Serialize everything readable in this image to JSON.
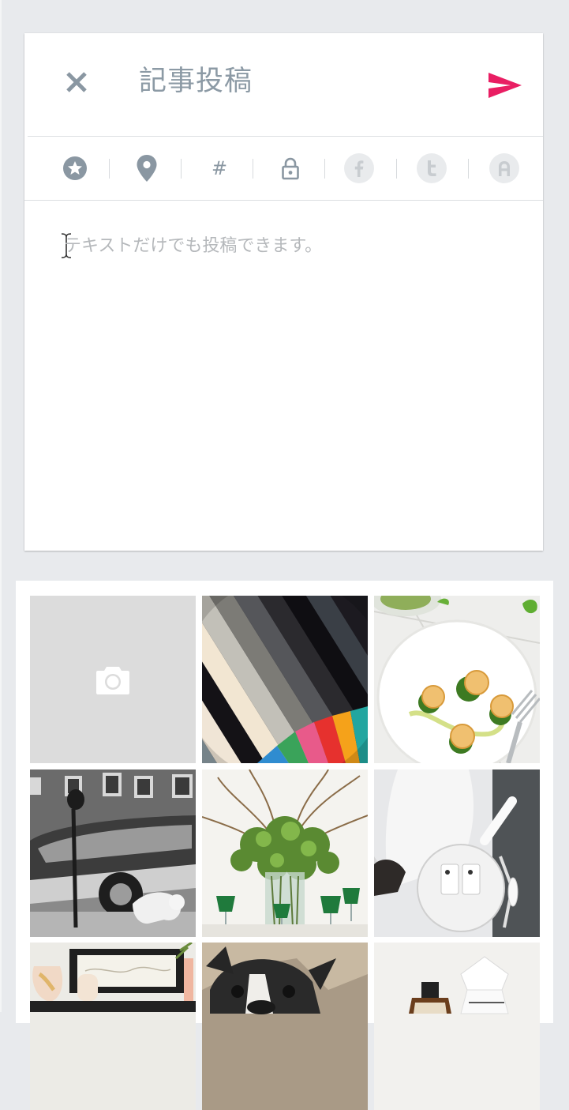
{
  "header": {
    "title": "記事投稿",
    "close_icon": "close-icon",
    "send_icon": "send-icon"
  },
  "toolbar": {
    "items": [
      {
        "icon": "star-icon"
      },
      {
        "icon": "location-pin-icon"
      },
      {
        "icon": "hashtag-icon",
        "glyph": "#"
      },
      {
        "icon": "lock-icon"
      },
      {
        "icon": "facebook-icon",
        "glyph": "f"
      },
      {
        "icon": "twitter-icon",
        "glyph": "t"
      },
      {
        "icon": "ameba-icon",
        "glyph": "A"
      }
    ]
  },
  "editor": {
    "placeholder": "テキストだけでも投稿できます。"
  },
  "gallery": {
    "camera_icon": "camera-icon",
    "photos": [
      {
        "name": "photo-striped-color-swatch"
      },
      {
        "name": "photo-food-plate"
      },
      {
        "name": "photo-street-car-dog"
      },
      {
        "name": "photo-flower-arrangement"
      },
      {
        "name": "photo-white-round-bag"
      },
      {
        "name": "photo-shelf-vases"
      },
      {
        "name": "photo-french-bulldog"
      },
      {
        "name": "photo-bottles"
      }
    ]
  },
  "colors": {
    "accent": "#e91e63",
    "icon_gray": "#8a97a2",
    "background": "#e8eaed"
  }
}
